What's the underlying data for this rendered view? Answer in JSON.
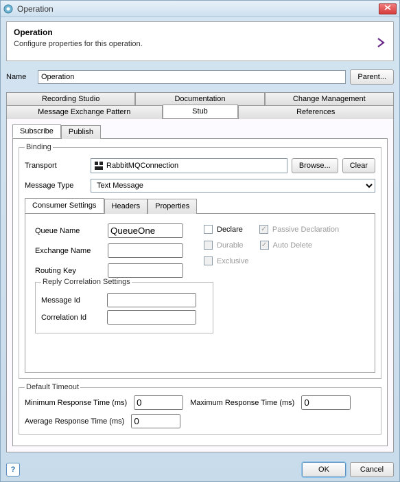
{
  "window": {
    "title": "Operation"
  },
  "header": {
    "title": "Operation",
    "description": "Configure properties for this operation."
  },
  "name": {
    "label": "Name",
    "value": "Operation",
    "parent_btn": "Parent..."
  },
  "outer_tabs": {
    "row1": [
      "Recording Studio",
      "Documentation",
      "Change Management"
    ],
    "row2": [
      "Message Exchange Pattern",
      "Stub",
      "References"
    ],
    "selected": "Stub"
  },
  "stub": {
    "sub_tabs": [
      "Subscribe",
      "Publish"
    ],
    "selected": "Subscribe",
    "binding": {
      "legend": "Binding",
      "transport_label": "Transport",
      "transport_value": "RabbitMQConnection",
      "browse_btn": "Browse...",
      "clear_btn": "Clear",
      "msgtype_label": "Message Type",
      "msgtype_value": "Text Message"
    },
    "cs_tabs": [
      "Consumer Settings",
      "Headers",
      "Properties"
    ],
    "cs_selected": "Consumer Settings",
    "consumer": {
      "queue_label": "Queue Name",
      "queue_value": "QueueOne",
      "exchange_label": "Exchange Name",
      "exchange_value": "",
      "routing_label": "Routing Key",
      "routing_value": "",
      "declare_label": "Declare",
      "passive_label": "Passive Declaration",
      "durable_label": "Durable",
      "autodelete_label": "Auto Delete",
      "exclusive_label": "Exclusive"
    },
    "reply": {
      "legend": "Reply Correlation Settings",
      "msgid_label": "Message Id",
      "msgid_value": "",
      "corrid_label": "Correlation Id",
      "corrid_value": ""
    }
  },
  "timeout": {
    "legend": "Default Timeout",
    "min_label": "Minimum Response Time (ms)",
    "min_value": "0",
    "max_label": "Maximum Response Time (ms)",
    "max_value": "0",
    "avg_label": "Average Response Time (ms)",
    "avg_value": "0"
  },
  "footer": {
    "ok": "OK",
    "cancel": "Cancel"
  }
}
